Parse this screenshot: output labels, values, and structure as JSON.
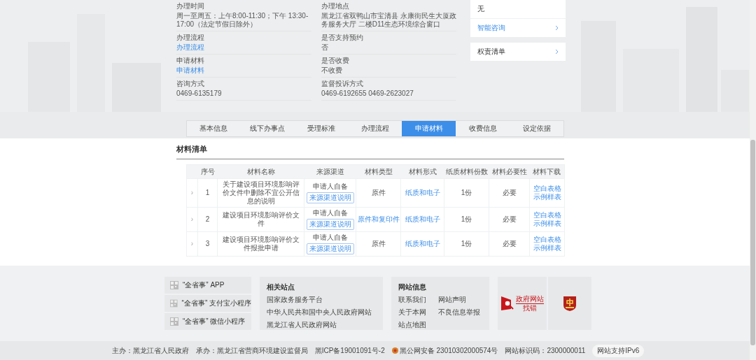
{
  "info": [
    {
      "label": "办理时间",
      "value": "周一至周五：上午8:00-11:30；下午 13:30-17:00（法定节假日除外）",
      "link": false
    },
    {
      "label": "办理地点",
      "value": "黑龙江省双鸭山市宝清县 永康街民生大厦政务服务大厅 二楼D11生态环境综合窗口",
      "link": false
    },
    {
      "label": "办理流程",
      "value": "办理流程",
      "link": true
    },
    {
      "label": "是否支持预约",
      "value": "否",
      "link": false
    },
    {
      "label": "申请材料",
      "value": "申请材料",
      "link": true
    },
    {
      "label": "是否收费",
      "value": "不收费",
      "link": false
    },
    {
      "label": "咨询方式",
      "value": "0469-6135179",
      "link": false
    },
    {
      "label": "监督投诉方式",
      "value": "0469-6192655 0469-2623027",
      "link": false
    }
  ],
  "side_cards": [
    {
      "items": [
        {
          "text": "无",
          "kind": "note"
        },
        {
          "text": "智能咨询",
          "kind": "link"
        }
      ]
    },
    {
      "items": [
        {
          "text": "权责清单",
          "kind": "menu"
        }
      ]
    }
  ],
  "tabs": [
    {
      "label": "基本信息",
      "selected": false
    },
    {
      "label": "线下办事点",
      "selected": false
    },
    {
      "label": "受理标准",
      "selected": false
    },
    {
      "label": "办理流程",
      "selected": false
    },
    {
      "label": "申请材料",
      "selected": true
    },
    {
      "label": "收费信息",
      "selected": false
    },
    {
      "label": "设定依据",
      "selected": false
    }
  ],
  "materials": {
    "title": "材料清单",
    "columns": [
      "序号",
      "材料名称",
      "来源渠道",
      "材料类型",
      "材料形式",
      "纸质材料份数",
      "材料必要性",
      "材料下载"
    ],
    "rows": [
      {
        "expander": "›",
        "number": "1",
        "name": "关于建设项目环境影响评价文件中删除不宜公开信息的说明",
        "source": "申请人自备",
        "source_button": "来源渠道说明",
        "type": {
          "text": "原件",
          "link": false
        },
        "form": "纸质和电子",
        "copies": "1份",
        "necessity": "必要",
        "downloads": [
          "空白表格",
          "示例样表"
        ]
      },
      {
        "expander": "›",
        "number": "2",
        "name": "建设项目环境影响评价文件",
        "source": "申请人自备",
        "source_button": "来源渠道说明",
        "type": {
          "text": "原件和复印件",
          "link": true
        },
        "form": "纸质和电子",
        "copies": "1份",
        "necessity": "必要",
        "downloads": [
          "空白表格",
          "示例样表"
        ]
      },
      {
        "expander": "›",
        "number": "3",
        "name": "建设项目环境影响评价文件报批申请",
        "source": "申请人自备",
        "source_button": "来源渠道说明",
        "type": {
          "text": "原件",
          "link": false
        },
        "form": "纸质和电子",
        "copies": "1份",
        "necessity": "必要",
        "downloads": [
          "空白表格",
          "示例样表"
        ]
      }
    ]
  },
  "footer": {
    "apps": [
      "“全省事” APP",
      "“全省事” 支付宝小程序",
      "“全省事” 微信小程序"
    ],
    "related_sites": {
      "title": "相关站点",
      "links": [
        "国家政务服务平台",
        "中华人民共和国中央人民政府网站",
        "黑龙江省人民政府网站"
      ]
    },
    "site_info": {
      "title": "网站信息",
      "links": [
        "联系我们",
        "网站声明",
        "关于本网",
        "不良信息举报",
        "站点地图"
      ]
    },
    "badges": [
      {
        "kind": "find-error",
        "lines": [
          "政府网站",
          "找错"
        ]
      },
      {
        "kind": "emblem"
      }
    ]
  },
  "bottom_bar": [
    {
      "text": "主办：黑龙江省人民政府",
      "kind": "text"
    },
    {
      "text": "承办：黑龙江省营商环境建设监督局",
      "kind": "text"
    },
    {
      "text": "黑ICP备19001091号-2",
      "kind": "text"
    },
    {
      "text": "黑公网安备 23010302000574号",
      "kind": "police"
    },
    {
      "text": "网站标识码：2300000011",
      "kind": "text"
    },
    {
      "text": "网站支持IPv6",
      "kind": "pill"
    }
  ]
}
